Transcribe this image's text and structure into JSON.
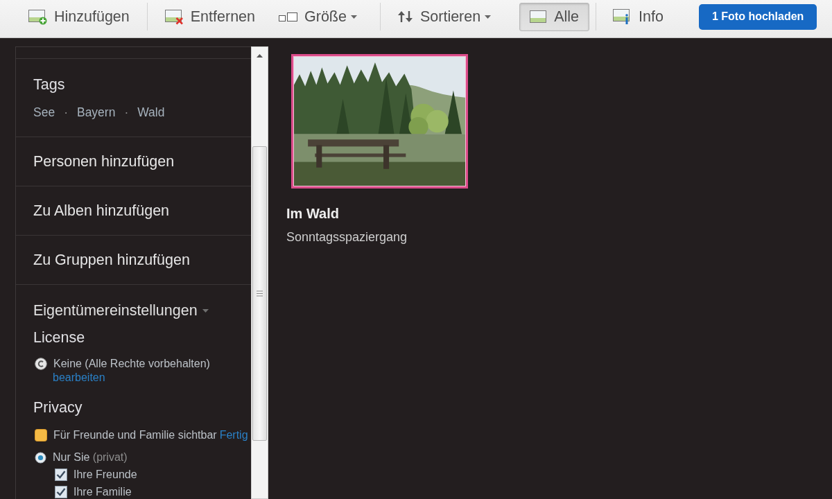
{
  "toolbar": {
    "groups": [
      [
        {
          "label": "Hinzufügen",
          "kind": "action"
        }
      ],
      [
        {
          "label": "Entfernen",
          "kind": "action"
        },
        {
          "label": "Größe",
          "kind": "dropdown"
        }
      ],
      [
        {
          "label": "Sortieren",
          "kind": "dropdown"
        },
        {
          "label": "Alle",
          "kind": "toggle",
          "selected": true
        }
      ],
      [
        {
          "label": "Info",
          "kind": "toggle",
          "selected": false
        }
      ]
    ],
    "upload_button": "1 Foto hochladen"
  },
  "sidebar": {
    "tags": {
      "title": "Tags",
      "items": [
        "See",
        "Bayern",
        "Wald"
      ],
      "separator": "·"
    },
    "links": [
      "Personen hinzufügen",
      "Zu Alben hinzufügen",
      "Zu Gruppen hinzufügen"
    ],
    "owner_settings": {
      "title": "Eigentümereinstellungen",
      "expanded": true,
      "license": {
        "heading": "License",
        "value": "Keine (Alle Rechte vorbehalten)",
        "edit_link": "bearbeiten"
      },
      "privacy": {
        "heading": "Privacy",
        "summary": "Für Freunde und Familie sichtbar",
        "done_link": "Fertig",
        "options": [
          {
            "kind": "radio",
            "label": "Nur Sie",
            "note": "(privat)",
            "selected": true
          },
          {
            "kind": "checkbox",
            "label": "Ihre Freunde",
            "checked": true
          },
          {
            "kind": "checkbox",
            "label": "Ihre Familie",
            "checked": true
          }
        ]
      }
    }
  },
  "photos": [
    {
      "title": "Im Wald",
      "description": "Sonntagsspaziergang",
      "selected": true
    }
  ]
}
